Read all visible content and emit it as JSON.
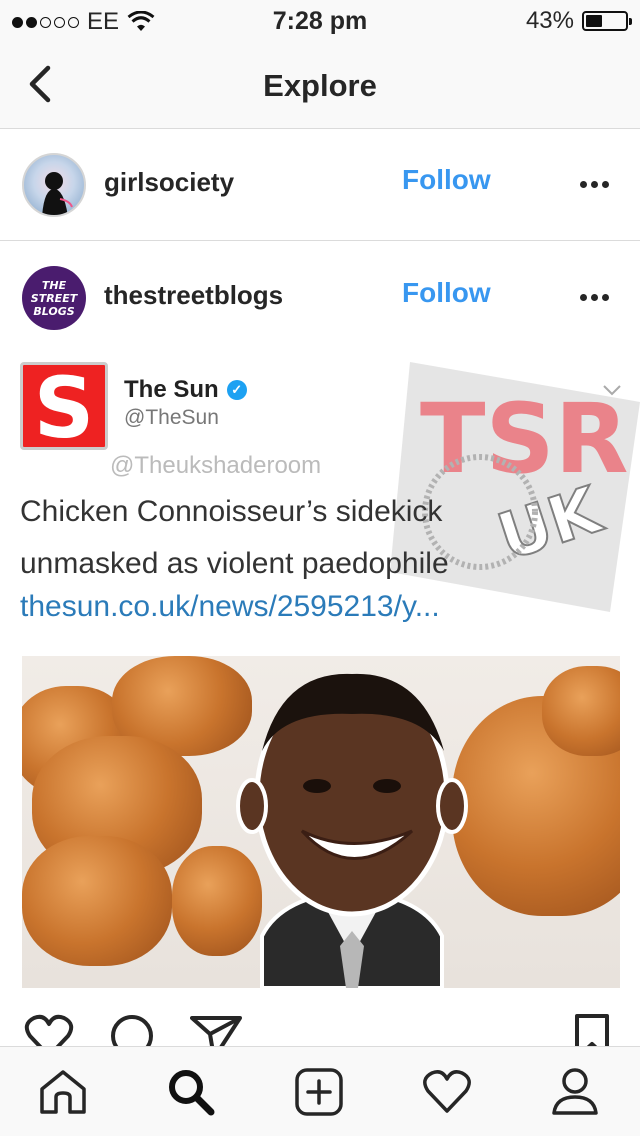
{
  "status_bar": {
    "carrier": "EE",
    "time": "7:28 pm",
    "battery_percent": "43%",
    "battery_level": 0.43,
    "signal_bars_filled": 2,
    "signal_bars_total": 5
  },
  "nav": {
    "title": "Explore",
    "back_icon": "chevron-left-icon"
  },
  "accounts": [
    {
      "username": "girlsociety",
      "follow_label": "Follow"
    },
    {
      "username": "thestreetblogs",
      "follow_label": "Follow",
      "avatar_text": [
        "THE",
        "STREET",
        "BLOGS"
      ]
    }
  ],
  "post": {
    "logo_letter": "S",
    "tweet_name": "The Sun",
    "tweet_handle": "@TheSun",
    "watermark": "@Theukshaderoom",
    "tweet_text": "Chicken Connoisseur’s sidekick unmasked as violent paedophile",
    "tweet_link": "thesun.co.uk/news/2595213/y...",
    "tsr_logo_text": "TSR",
    "tsr_logo_sub": "UK"
  },
  "actions": [
    "heart-icon",
    "comment-icon",
    "share-icon",
    "bookmark-icon"
  ],
  "tabs": [
    "home-icon",
    "search-icon",
    "add-icon",
    "activity-heart-icon",
    "profile-icon"
  ],
  "colors": {
    "accent": "#3897f0",
    "text": "#262626",
    "divider": "#dbdbdb",
    "sun_red": "#e22222",
    "link": "#2b7bb9"
  }
}
